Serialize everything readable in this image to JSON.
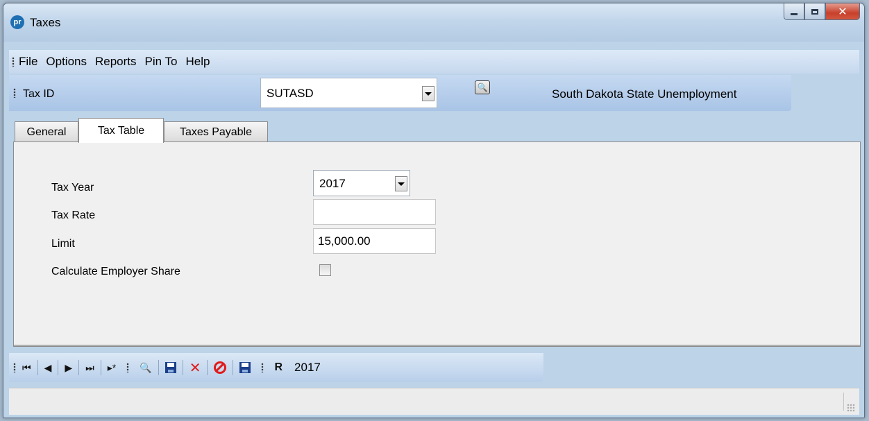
{
  "window": {
    "title": "Taxes",
    "app_icon": "pr"
  },
  "menu": [
    "File",
    "Options",
    "Reports",
    "Pin To",
    "Help"
  ],
  "tax_id_bar": {
    "label": "Tax ID",
    "value": "SUTASD",
    "description": "South Dakota State Unemployment"
  },
  "tabs": [
    "General",
    "Tax Table",
    "Taxes Payable"
  ],
  "active_tab": "Tax Table",
  "form": {
    "tax_year_label": "Tax Year",
    "tax_year_value": "2017",
    "tax_rate_label": "Tax Rate",
    "tax_rate_value": "",
    "limit_label": "Limit",
    "limit_value": "15,000.00",
    "employer_share_label": "Calculate Employer Share",
    "employer_share_checked": false
  },
  "navigator": {
    "first": "⏮",
    "prev": "◀",
    "next": "▶",
    "last": "⏭",
    "new": "▸*",
    "year": "2017"
  },
  "colors": {
    "toolbar_blue": "#bcd3e8",
    "close_red": "#c7402b",
    "delete_red": "#e01b1b",
    "save_blue": "#1b3f8b"
  }
}
